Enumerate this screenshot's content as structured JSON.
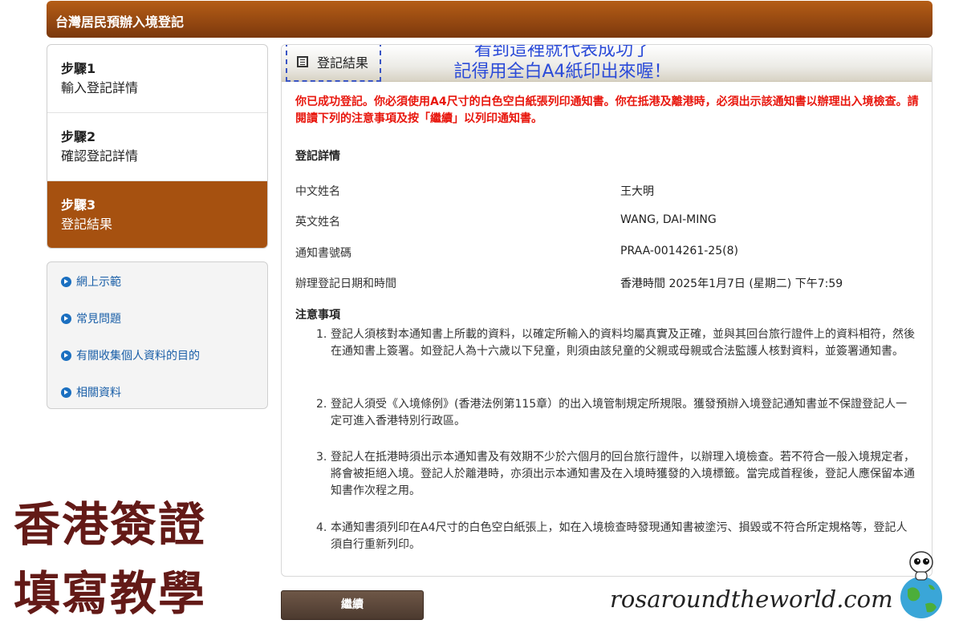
{
  "header": {
    "title": "台灣居民預辦入境登記"
  },
  "steps": [
    {
      "num": "步驟1",
      "label": "輸入登記詳情"
    },
    {
      "num": "步驟2",
      "label": "確認登記詳情"
    },
    {
      "num": "步驟3",
      "label": "登記結果"
    }
  ],
  "links": [
    "網上示範",
    "常見問題",
    "有關收集個人資料的目的",
    "相關資料"
  ],
  "panel": {
    "head_label": "登記結果",
    "annotation": [
      "看到這裡就代表成功了",
      "記得用全白A4紙印出來喔！"
    ],
    "notice": "你已成功登記。你必須使用A4尺寸的白色空白紙張列印通知書。你在抵港及離港時，必須出示該通知書以辦理出入境檢查。請閱讀下列的注意事項及按「繼續」以列印通知書。",
    "details_title": "登記詳情",
    "details": [
      {
        "label": "中文姓名",
        "value": "王大明"
      },
      {
        "label": "英文姓名",
        "value": "WANG, DAI-MING"
      },
      {
        "label": "通知書號碼",
        "value": "PRAA-0014261-25(8)"
      },
      {
        "label": "辦理登記日期和時間",
        "value": "香港時間 2025年1月7日 (星期二) 下午7:59"
      }
    ],
    "notes_title": "注意事項",
    "notes": [
      {
        "n": "1.",
        "text": "登記人須核對本通知書上所載的資料，以確定所輸入的資料均屬真實及正確，並與其回台旅行證件上的資料相符，然後在通知書上簽署。如登記人為十六歲以下兒童，則須由該兒童的父親或母親或合法監護人核對資料，並簽署通知書。"
      },
      {
        "n": "2.",
        "text": "登記人須受《入境條例》(香港法例第115章）的出入境管制規定所規限。獲發預辦入境登記通知書並不保證登記人一定可進入香港特別行政區。"
      },
      {
        "n": "3.",
        "text": "登記人在抵港時須出示本通知書及有效期不少於六個月的回台旅行證件，以辦理入境檢查。若不符合一般入境規定者，將會被拒絕入境。登記人於離港時，亦須出示本通知書及在入境時獲發的入境標籤。當完成首程後，登記人應保留本通知書作次程之用。"
      },
      {
        "n": "4.",
        "text": "本通知書須列印在A4尺寸的白色空白紙張上，如在入境檢查時發現通知書被塗污、損毀或不符合所定規格等，登記人須自行重新列印。"
      }
    ]
  },
  "continue_label": "繼續",
  "overlay": {
    "title_lines": [
      "香港簽證",
      "填寫教學"
    ],
    "site": "rosaroundtheworld.com"
  }
}
